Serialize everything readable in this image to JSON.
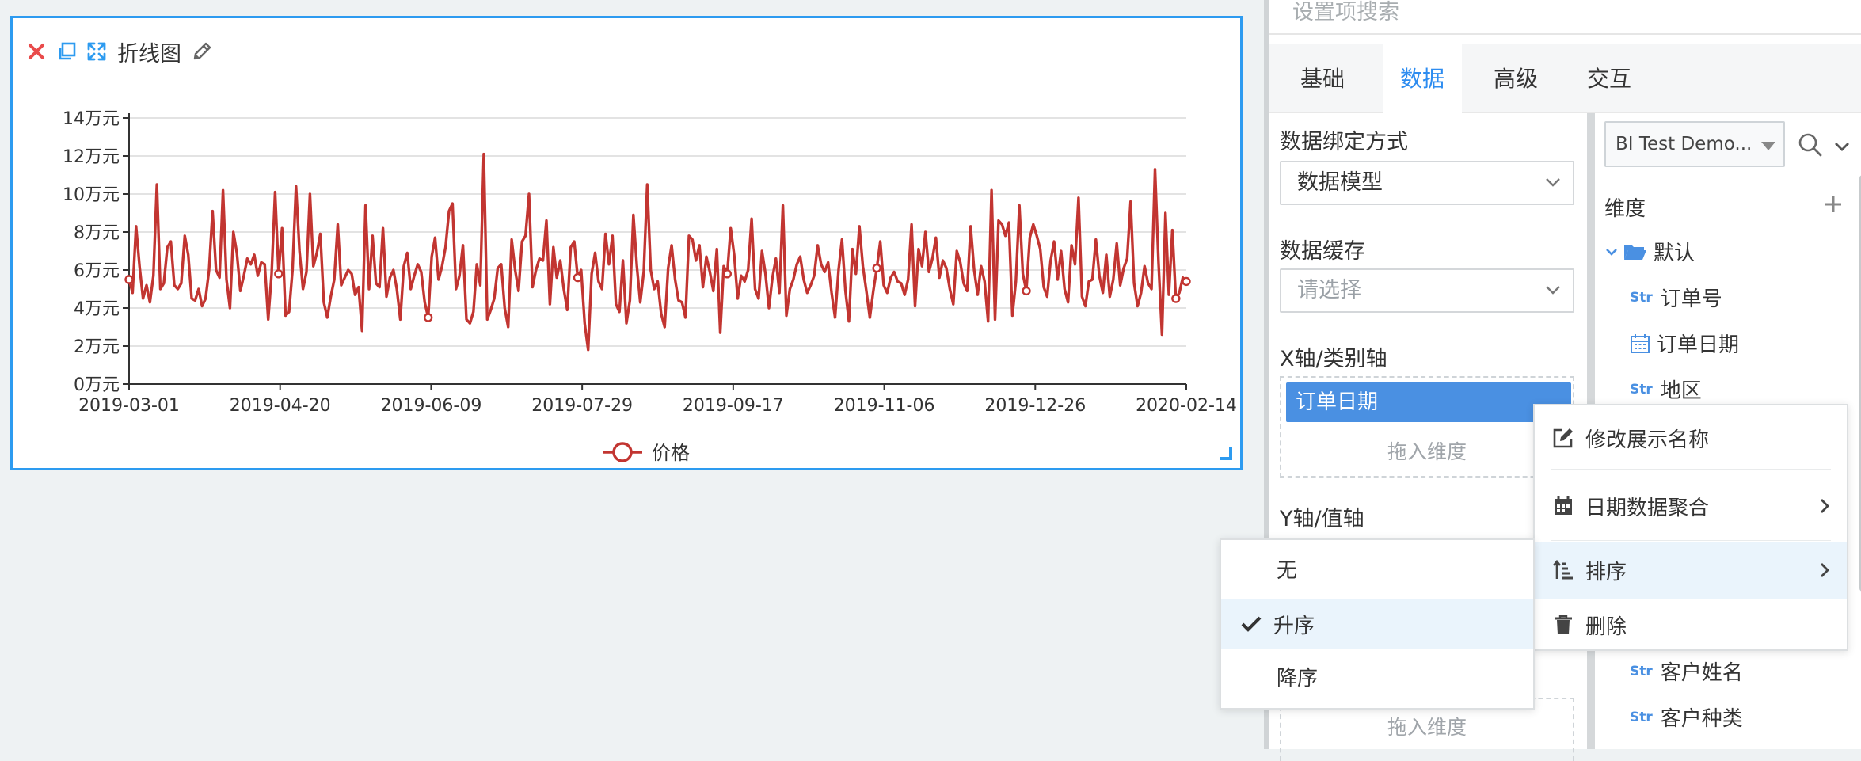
{
  "widget": {
    "title": "折线图",
    "icons": [
      "close-icon",
      "copy-icon",
      "expand-icon",
      "edit-icon"
    ],
    "legend": "价格"
  },
  "chart_data": {
    "type": "line",
    "x_start": "2019-03-01",
    "x_end": "2020-02-14",
    "x_ticks": [
      "2019-03-01",
      "2019-04-20",
      "2019-06-09",
      "2019-07-29",
      "2019-09-17",
      "2019-11-06",
      "2019-12-26",
      "2020-02-14"
    ],
    "y_ticks": [
      "0万元",
      "2万元",
      "4万元",
      "6万元",
      "8万元",
      "10万元",
      "12万元",
      "14万元"
    ],
    "ylim": [
      0,
      140000
    ],
    "grid": true,
    "legend_position": "bottom-center",
    "series": [
      {
        "name": "价格",
        "color": "#c23531",
        "values": [
          55000,
          48000,
          83000,
          62000,
          45000,
          52000,
          43000,
          57000,
          105000,
          50000,
          53000,
          72000,
          75000,
          52000,
          50000,
          53000,
          78000,
          68000,
          45000,
          44000,
          50000,
          41000,
          45000,
          60000,
          91000,
          60000,
          56000,
          102000,
          55000,
          40000,
          80000,
          69000,
          49000,
          57000,
          66000,
          63000,
          68000,
          57000,
          64000,
          63000,
          34000,
          58000,
          101000,
          58000,
          82000,
          36000,
          38000,
          60000,
          104000,
          70000,
          50000,
          59000,
          100000,
          62000,
          69000,
          79000,
          43000,
          35000,
          46000,
          55000,
          84000,
          52000,
          56000,
          60000,
          58000,
          47000,
          51000,
          28000,
          94000,
          50000,
          78000,
          53000,
          51000,
          82000,
          46000,
          56000,
          60000,
          50000,
          34000,
          62000,
          69000,
          50000,
          57000,
          63000,
          59000,
          43000,
          35000,
          67000,
          77000,
          55000,
          62000,
          72000,
          91000,
          95000,
          50000,
          57000,
          73000,
          34000,
          32000,
          38000,
          63000,
          52000,
          121000,
          34000,
          39000,
          45000,
          61000,
          63000,
          40000,
          30000,
          76000,
          60000,
          49000,
          75000,
          78000,
          100000,
          51000,
          60000,
          66000,
          65000,
          86000,
          42000,
          72000,
          56000,
          65000,
          50000,
          39000,
          72000,
          75000,
          56000,
          60000,
          32000,
          18000,
          58000,
          69000,
          54000,
          50000,
          79000,
          63000,
          78000,
          42000,
          38000,
          65000,
          32000,
          44000,
          89000,
          62000,
          43000,
          59000,
          105000,
          60000,
          50000,
          54000,
          37000,
          30000,
          61000,
          73000,
          55000,
          44000,
          43000,
          35000,
          78000,
          76000,
          65000,
          73000,
          51000,
          67000,
          59000,
          49000,
          71000,
          27000,
          62000,
          58000,
          82000,
          68000,
          45000,
          57000,
          54000,
          60000,
          87000,
          50000,
          45000,
          70000,
          58000,
          40000,
          56000,
          66000,
          48000,
          94000,
          36000,
          50000,
          55000,
          63000,
          67000,
          55000,
          48000,
          52000,
          57000,
          73000,
          63000,
          59000,
          64000,
          48000,
          35000,
          60000,
          76000,
          49000,
          33000,
          71000,
          58000,
          83000,
          62000,
          49000,
          35000,
          49000,
          61000,
          75000,
          52000,
          48000,
          56000,
          59000,
          54000,
          53000,
          47000,
          55000,
          84000,
          41000,
          71000,
          62000,
          80000,
          59000,
          66000,
          77000,
          56000,
          65000,
          61000,
          50000,
          42000,
          70000,
          64000,
          53000,
          49000,
          83000,
          60000,
          47000,
          62000,
          54000,
          33000,
          102000,
          34000,
          86000,
          84000,
          78000,
          85000,
          36000,
          54000,
          94000,
          58000,
          49000,
          77000,
          84000,
          78000,
          71000,
          51000,
          46000,
          65000,
          75000,
          55000,
          70000,
          50000,
          43000,
          73000,
          63000,
          98000,
          46000,
          41000,
          54000,
          55000,
          76000,
          57000,
          48000,
          68000,
          46000,
          55000,
          74000,
          52000,
          61000,
          66000,
          96000,
          53000,
          41000,
          48000,
          62000,
          53000,
          50000,
          113000,
          64000,
          26000,
          90000,
          47000,
          81000,
          45000,
          48000,
          56000,
          54000
        ]
      }
    ]
  },
  "panel": {
    "search_placeholder": "设置项搜索",
    "tabs": [
      "基础",
      "数据",
      "高级",
      "交互"
    ],
    "active_tab": "数据",
    "accent": "#2d8cf0",
    "bind_label": "数据绑定方式",
    "bind_value": "数据模型",
    "cache_label": "数据缓存",
    "cache_placeholder": "请选择",
    "x_axis_label": "X轴/类别轴",
    "x_axis_chip": "订单日期",
    "drop_hint": "拖入维度",
    "y_axis_label": "Y轴/值轴",
    "drop_hint_bottom": "拖入维度",
    "datasource": "BI Test Demo...",
    "dimension_label": "维度",
    "folder": "默认",
    "fields": [
      {
        "type": "Str",
        "label": "订单号"
      },
      {
        "type": "date",
        "label": "订单日期"
      },
      {
        "type": "Str",
        "label": "地区"
      },
      {
        "type": "Str",
        "label": "客户姓名"
      },
      {
        "type": "Str",
        "label": "客户种类"
      }
    ]
  },
  "context_menu": {
    "items": [
      "修改展示名称",
      "日期数据聚合",
      "排序",
      "删除"
    ]
  },
  "sort_menu": {
    "items": [
      "无",
      "升序",
      "降序"
    ],
    "selected": "升序"
  }
}
